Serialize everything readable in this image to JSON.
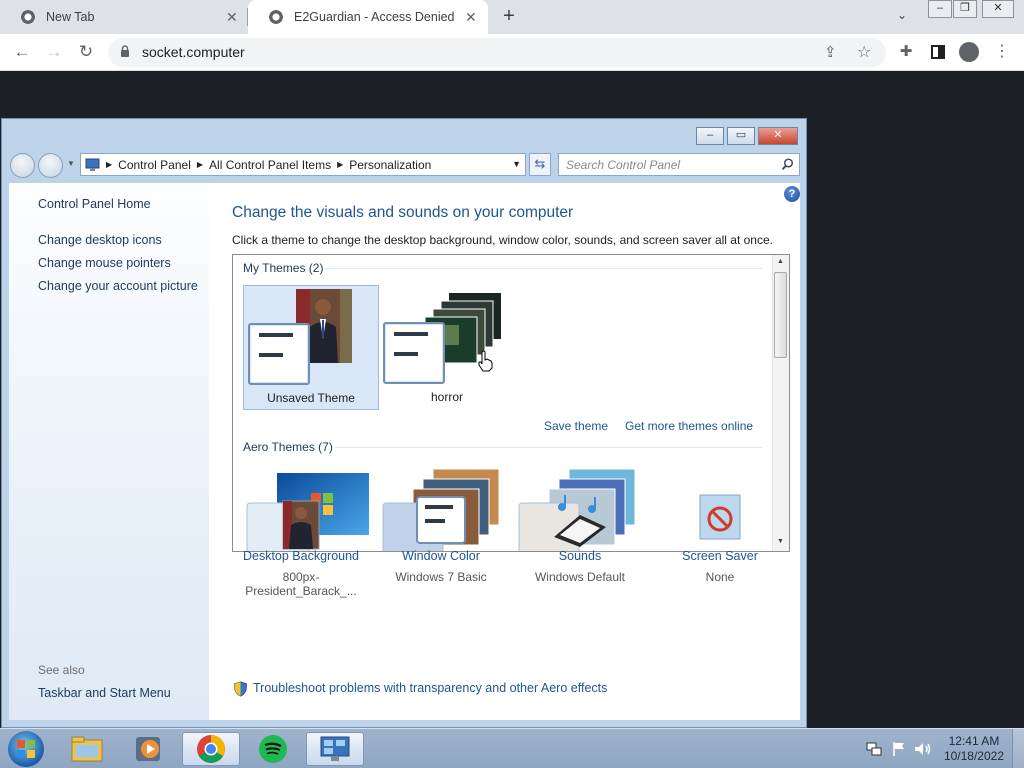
{
  "browser": {
    "tabs": [
      {
        "title": "New Tab",
        "active": false
      },
      {
        "title": "E2Guardian - Access Denied",
        "active": true
      }
    ],
    "url": "socket.computer"
  },
  "window": {
    "breadcrumb": [
      "Control Panel",
      "All Control Panel Items",
      "Personalization"
    ],
    "search_placeholder": "Search Control Panel"
  },
  "sidebar": {
    "home": "Control Panel Home",
    "links": [
      "Change desktop icons",
      "Change mouse pointers",
      "Change your account picture"
    ],
    "see_also_label": "See also",
    "see_also_links": [
      "Taskbar and Start Menu"
    ]
  },
  "main": {
    "heading": "Change the visuals and sounds on your computer",
    "description": "Click a theme to change the desktop background, window color, sounds, and screen saver all at once.",
    "my_themes_label": "My Themes (2)",
    "my_themes": [
      {
        "name": "Unsaved Theme",
        "selected": true
      },
      {
        "name": "horror",
        "selected": false
      }
    ],
    "save_theme": "Save theme",
    "get_more_themes": "Get more themes online",
    "aero_themes_label": "Aero Themes (7)",
    "bottom_items": [
      {
        "label": "Desktop Background",
        "sub": "800px-President_Barack_..."
      },
      {
        "label": "Window Color",
        "sub": "Windows 7 Basic"
      },
      {
        "label": "Sounds",
        "sub": "Windows Default"
      },
      {
        "label": "Screen Saver",
        "sub": "None"
      }
    ],
    "troubleshoot": "Troubleshoot problems with transparency and other Aero effects"
  },
  "taskbar": {
    "time": "12:41 AM",
    "date": "10/18/2022"
  },
  "colors": {
    "link": "#1e5591",
    "heading": "#1e5591",
    "desktop": "#1c1f26"
  }
}
